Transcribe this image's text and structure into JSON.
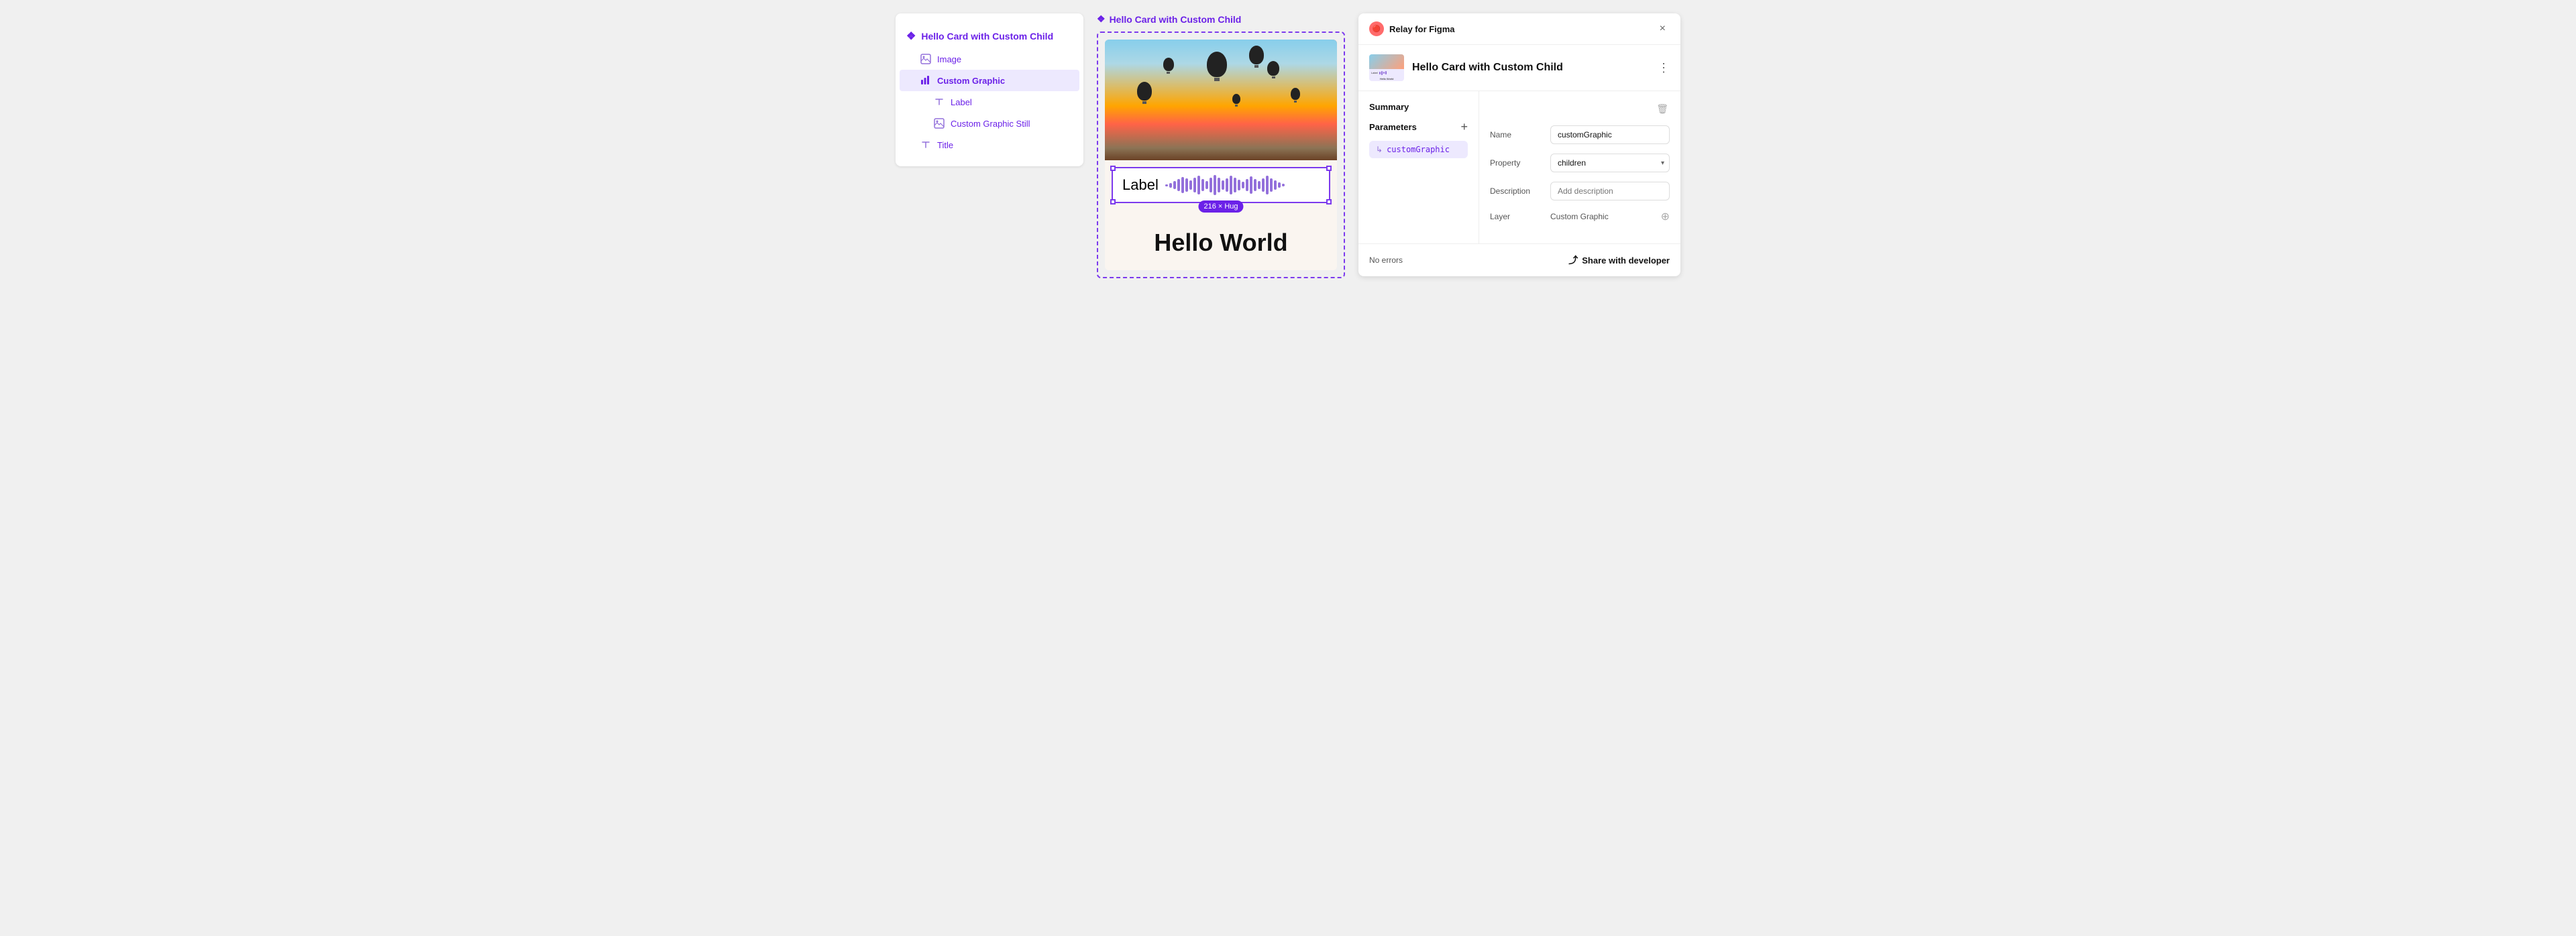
{
  "leftPanel": {
    "rootItem": {
      "label": "Hello Card with Custom Child",
      "icon": "❖"
    },
    "items": [
      {
        "id": "image",
        "label": "Image",
        "icon": "image",
        "indent": 1,
        "selected": false
      },
      {
        "id": "custom-graphic",
        "label": "Custom Graphic",
        "icon": "bar-chart",
        "indent": 1,
        "selected": true
      },
      {
        "id": "label",
        "label": "Label",
        "icon": "text",
        "indent": 2,
        "selected": false
      },
      {
        "id": "custom-graphic-still",
        "label": "Custom Graphic Still",
        "icon": "image",
        "indent": 2,
        "selected": false
      },
      {
        "id": "title",
        "label": "Title",
        "icon": "text",
        "indent": 1,
        "selected": false
      }
    ]
  },
  "middlePanel": {
    "title": "Hello Card with Custom Child",
    "titleIcon": "❖",
    "labelText": "Label",
    "sizeBadge": "216 × Hug",
    "helloWorld": "Hello World"
  },
  "rightPanel": {
    "appName": "Relay for Figma",
    "closeBtn": "×",
    "componentTitle": "Hello Card with Custom Child",
    "summary": {
      "label": "Summary",
      "paramName": "customGraphic"
    },
    "parameters": {
      "label": "Parameters",
      "addBtn": "+",
      "items": [
        {
          "id": "customGraphic",
          "name": "customGraphic"
        }
      ]
    },
    "details": {
      "nameLabel": "Name",
      "nameValue": "customGraphic",
      "propertyLabel": "Property",
      "propertyValue": "children",
      "descriptionLabel": "Description",
      "descriptionPlaceholder": "Add description",
      "layerLabel": "Layer",
      "layerValue": "Custom Graphic"
    },
    "footer": {
      "noErrors": "No errors",
      "shareBtn": "Share with developer"
    }
  },
  "waveformBars": [
    3,
    7,
    12,
    18,
    24,
    20,
    14,
    22,
    28,
    18,
    12,
    22,
    30,
    22,
    14,
    20,
    28,
    22,
    16,
    10,
    18,
    26,
    18,
    12,
    20,
    28,
    20,
    14,
    8,
    4
  ]
}
